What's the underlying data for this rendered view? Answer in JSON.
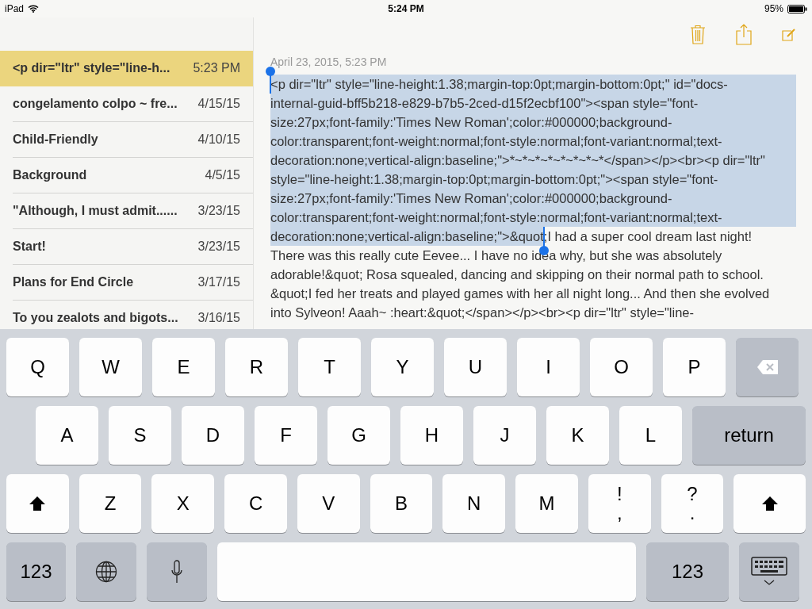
{
  "status_bar": {
    "device": "iPad",
    "time": "5:24 PM",
    "battery": "95%"
  },
  "notes": [
    {
      "title": "<p dir=\"ltr\" style=\"line-h...",
      "date": "5:23 PM",
      "selected": true
    },
    {
      "title": "congelamento colpo ~ fre...",
      "date": "4/15/15",
      "selected": false
    },
    {
      "title": "Child-Friendly",
      "date": "4/10/15",
      "selected": false
    },
    {
      "title": "Background",
      "date": "4/5/15",
      "selected": false
    },
    {
      "title": "\"Although, I must admit......",
      "date": "3/23/15",
      "selected": false
    },
    {
      "title": "Start!",
      "date": "3/23/15",
      "selected": false
    },
    {
      "title": "Plans for End Circle",
      "date": "3/17/15",
      "selected": false
    },
    {
      "title": "To you zealots and bigots...",
      "date": "3/16/15",
      "selected": false
    }
  ],
  "toolbar": [
    {
      "kind": "trash"
    },
    {
      "kind": "share"
    },
    {
      "kind": "compose"
    }
  ],
  "note": {
    "date": "April 23, 2015, 5:23 PM",
    "lines": [
      {
        "selected": "<p dir=\"ltr\" style=\"line-height:1.38;margin-top:0pt;margin-bottom:0pt;\" id=\"docs-"
      },
      {
        "selected": "internal-guid-bff5b218-e829-b7b5-2ced-d15f2ecbf100\"><span style=\"font-"
      },
      {
        "selected": "size:27px;font-family:'Times New Roman';color:#000000;background-"
      },
      {
        "selected": "color:transparent;font-weight:normal;font-style:normal;font-variant:normal;text-"
      },
      {
        "selected": "decoration:none;vertical-align:baseline;\">*~*~*~*~*~*~*~*</span></p><br><p dir=\"ltr\""
      },
      {
        "selected": "style=\"line-height:1.38;margin-top:0pt;margin-bottom:0pt;\"><span style=\"font-"
      },
      {
        "selected": "size:27px;font-family:'Times New Roman';color:#000000;background-"
      },
      {
        "selected": "color:transparent;font-weight:normal;font-style:normal;font-variant:normal;text-"
      },
      {
        "selected": "decoration:none;vertical-align:baseline;\">&quot",
        "rest": ";I had a super cool dream last night!"
      },
      {
        "rest": "There was this really cute Eevee... I have no idea why, but she was absolutely"
      },
      {
        "rest": "adorable!&quot; Rosa squealed, dancing and skipping on their normal path to school."
      },
      {
        "rest": "&quot;I fed her treats and played games with her all night long... And then she evolved"
      },
      {
        "rest": "into Sylveon! Aaah~ :heart:&quot;</span></p><br><p dir=\"ltr\" style=\"line-"
      }
    ]
  },
  "keyboard": [
    [
      {
        "kind": "letter",
        "label": "Q"
      },
      {
        "kind": "letter",
        "label": "W"
      },
      {
        "kind": "letter",
        "label": "E"
      },
      {
        "kind": "letter",
        "label": "R"
      },
      {
        "kind": "letter",
        "label": "T"
      },
      {
        "kind": "letter",
        "label": "Y"
      },
      {
        "kind": "letter",
        "label": "U"
      },
      {
        "kind": "letter",
        "label": "I"
      },
      {
        "kind": "letter",
        "label": "O"
      },
      {
        "kind": "letter",
        "label": "P"
      },
      {
        "kind": "delete"
      }
    ],
    [
      {
        "kind": "letter",
        "label": "A"
      },
      {
        "kind": "letter",
        "label": "S"
      },
      {
        "kind": "letter",
        "label": "D"
      },
      {
        "kind": "letter",
        "label": "F"
      },
      {
        "kind": "letter",
        "label": "G"
      },
      {
        "kind": "letter",
        "label": "H"
      },
      {
        "kind": "letter",
        "label": "J"
      },
      {
        "kind": "letter",
        "label": "K"
      },
      {
        "kind": "letter",
        "label": "L"
      },
      {
        "kind": "return",
        "label": "return"
      }
    ],
    [
      {
        "kind": "shift"
      },
      {
        "kind": "letter",
        "label": "Z"
      },
      {
        "kind": "letter",
        "label": "X"
      },
      {
        "kind": "letter",
        "label": "C"
      },
      {
        "kind": "letter",
        "label": "V"
      },
      {
        "kind": "letter",
        "label": "B"
      },
      {
        "kind": "letter",
        "label": "N"
      },
      {
        "kind": "letter",
        "label": "M"
      },
      {
        "kind": "pair",
        "top": "!",
        "bottom": ","
      },
      {
        "kind": "pair",
        "top": "?",
        "bottom": "."
      },
      {
        "kind": "shift"
      }
    ],
    [
      {
        "kind": "numbers",
        "label": "123"
      },
      {
        "kind": "globe"
      },
      {
        "kind": "mic"
      },
      {
        "kind": "space"
      },
      {
        "kind": "numbers_wide",
        "label": "123"
      },
      {
        "kind": "hide"
      }
    ]
  ]
}
